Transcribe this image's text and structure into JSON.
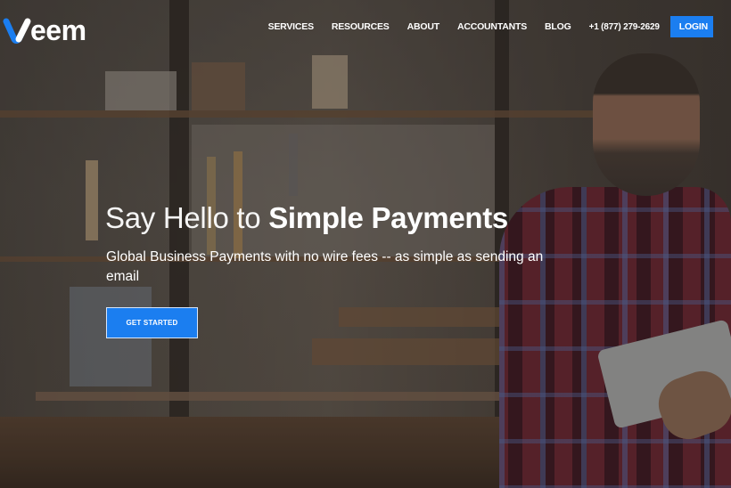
{
  "brand": {
    "name": "veem",
    "accent_color": "#1b7ef0",
    "logo_icon": "veem-v-check-logo"
  },
  "nav": {
    "items": [
      {
        "label": "SERVICES"
      },
      {
        "label": "RESOURCES"
      },
      {
        "label": "ABOUT"
      },
      {
        "label": "ACCOUNTANTS"
      },
      {
        "label": "BLOG"
      }
    ],
    "phone": "+1 (877) 279-2629",
    "login_label": "LOGIN"
  },
  "hero": {
    "headline_light": "Say Hello to ",
    "headline_bold": "Simple Payments",
    "subheadline": "Global Business Payments with no wire fees -- as simple as sending an email",
    "cta_label": "GET STARTED",
    "background_image": "man-in-plaid-shirt-using-tablet-in-woodworking-workshop"
  }
}
